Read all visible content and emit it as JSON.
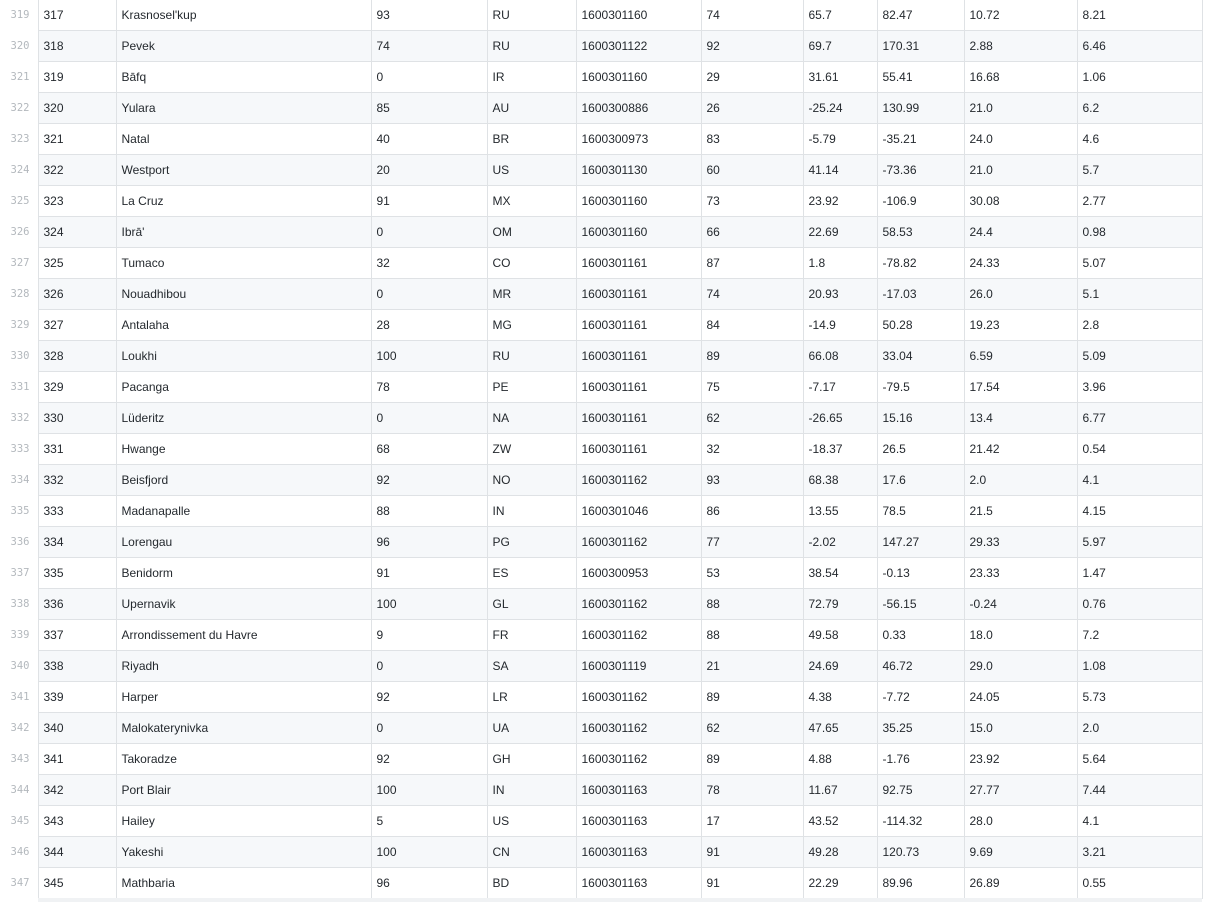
{
  "table": {
    "rows": [
      {
        "line": "319",
        "cells": [
          "317",
          "Krasnosel'kup",
          "93",
          "RU",
          "1600301160",
          "74",
          "65.7",
          "82.47",
          "10.72",
          "8.21"
        ]
      },
      {
        "line": "320",
        "cells": [
          "318",
          "Pevek",
          "74",
          "RU",
          "1600301122",
          "92",
          "69.7",
          "170.31",
          "2.88",
          "6.46"
        ]
      },
      {
        "line": "321",
        "cells": [
          "319",
          "Bāfq",
          "0",
          "IR",
          "1600301160",
          "29",
          "31.61",
          "55.41",
          "16.68",
          "1.06"
        ]
      },
      {
        "line": "322",
        "cells": [
          "320",
          "Yulara",
          "85",
          "AU",
          "1600300886",
          "26",
          "-25.24",
          "130.99",
          "21.0",
          "6.2"
        ]
      },
      {
        "line": "323",
        "cells": [
          "321",
          "Natal",
          "40",
          "BR",
          "1600300973",
          "83",
          "-5.79",
          "-35.21",
          "24.0",
          "4.6"
        ]
      },
      {
        "line": "324",
        "cells": [
          "322",
          "Westport",
          "20",
          "US",
          "1600301130",
          "60",
          "41.14",
          "-73.36",
          "21.0",
          "5.7"
        ]
      },
      {
        "line": "325",
        "cells": [
          "323",
          "La Cruz",
          "91",
          "MX",
          "1600301160",
          "73",
          "23.92",
          "-106.9",
          "30.08",
          "2.77"
        ]
      },
      {
        "line": "326",
        "cells": [
          "324",
          "Ibrā'",
          "0",
          "OM",
          "1600301160",
          "66",
          "22.69",
          "58.53",
          "24.4",
          "0.98"
        ]
      },
      {
        "line": "327",
        "cells": [
          "325",
          "Tumaco",
          "32",
          "CO",
          "1600301161",
          "87",
          "1.8",
          "-78.82",
          "24.33",
          "5.07"
        ]
      },
      {
        "line": "328",
        "cells": [
          "326",
          "Nouadhibou",
          "0",
          "MR",
          "1600301161",
          "74",
          "20.93",
          "-17.03",
          "26.0",
          "5.1"
        ]
      },
      {
        "line": "329",
        "cells": [
          "327",
          "Antalaha",
          "28",
          "MG",
          "1600301161",
          "84",
          "-14.9",
          "50.28",
          "19.23",
          "2.8"
        ]
      },
      {
        "line": "330",
        "cells": [
          "328",
          "Loukhi",
          "100",
          "RU",
          "1600301161",
          "89",
          "66.08",
          "33.04",
          "6.59",
          "5.09"
        ]
      },
      {
        "line": "331",
        "cells": [
          "329",
          "Pacanga",
          "78",
          "PE",
          "1600301161",
          "75",
          "-7.17",
          "-79.5",
          "17.54",
          "3.96"
        ]
      },
      {
        "line": "332",
        "cells": [
          "330",
          "Lüderitz",
          "0",
          "NA",
          "1600301161",
          "62",
          "-26.65",
          "15.16",
          "13.4",
          "6.77"
        ]
      },
      {
        "line": "333",
        "cells": [
          "331",
          "Hwange",
          "68",
          "ZW",
          "1600301161",
          "32",
          "-18.37",
          "26.5",
          "21.42",
          "0.54"
        ]
      },
      {
        "line": "334",
        "cells": [
          "332",
          "Beisfjord",
          "92",
          "NO",
          "1600301162",
          "93",
          "68.38",
          "17.6",
          "2.0",
          "4.1"
        ]
      },
      {
        "line": "335",
        "cells": [
          "333",
          "Madanapalle",
          "88",
          "IN",
          "1600301046",
          "86",
          "13.55",
          "78.5",
          "21.5",
          "4.15"
        ]
      },
      {
        "line": "336",
        "cells": [
          "334",
          "Lorengau",
          "96",
          "PG",
          "1600301162",
          "77",
          "-2.02",
          "147.27",
          "29.33",
          "5.97"
        ]
      },
      {
        "line": "337",
        "cells": [
          "335",
          "Benidorm",
          "91",
          "ES",
          "1600300953",
          "53",
          "38.54",
          "-0.13",
          "23.33",
          "1.47"
        ]
      },
      {
        "line": "338",
        "cells": [
          "336",
          "Upernavik",
          "100",
          "GL",
          "1600301162",
          "88",
          "72.79",
          "-56.15",
          "-0.24",
          "0.76"
        ]
      },
      {
        "line": "339",
        "cells": [
          "337",
          "Arrondissement du Havre",
          "9",
          "FR",
          "1600301162",
          "88",
          "49.58",
          "0.33",
          "18.0",
          "7.2"
        ]
      },
      {
        "line": "340",
        "cells": [
          "338",
          "Riyadh",
          "0",
          "SA",
          "1600301119",
          "21",
          "24.69",
          "46.72",
          "29.0",
          "1.08"
        ]
      },
      {
        "line": "341",
        "cells": [
          "339",
          "Harper",
          "92",
          "LR",
          "1600301162",
          "89",
          "4.38",
          "-7.72",
          "24.05",
          "5.73"
        ]
      },
      {
        "line": "342",
        "cells": [
          "340",
          "Malokaterynivka",
          "0",
          "UA",
          "1600301162",
          "62",
          "47.65",
          "35.25",
          "15.0",
          "2.0"
        ]
      },
      {
        "line": "343",
        "cells": [
          "341",
          "Takoradze",
          "92",
          "GH",
          "1600301162",
          "89",
          "4.88",
          "-1.76",
          "23.92",
          "5.64"
        ]
      },
      {
        "line": "344",
        "cells": [
          "342",
          "Port Blair",
          "100",
          "IN",
          "1600301163",
          "78",
          "11.67",
          "92.75",
          "27.77",
          "7.44"
        ]
      },
      {
        "line": "345",
        "cells": [
          "343",
          "Hailey",
          "5",
          "US",
          "1600301163",
          "17",
          "43.52",
          "-114.32",
          "28.0",
          "4.1"
        ]
      },
      {
        "line": "346",
        "cells": [
          "344",
          "Yakeshi",
          "100",
          "CN",
          "1600301163",
          "91",
          "49.28",
          "120.73",
          "9.69",
          "3.21"
        ]
      },
      {
        "line": "347",
        "cells": [
          "345",
          "Mathbaria",
          "96",
          "BD",
          "1600301163",
          "91",
          "22.29",
          "89.96",
          "26.89",
          "0.55"
        ]
      }
    ]
  }
}
